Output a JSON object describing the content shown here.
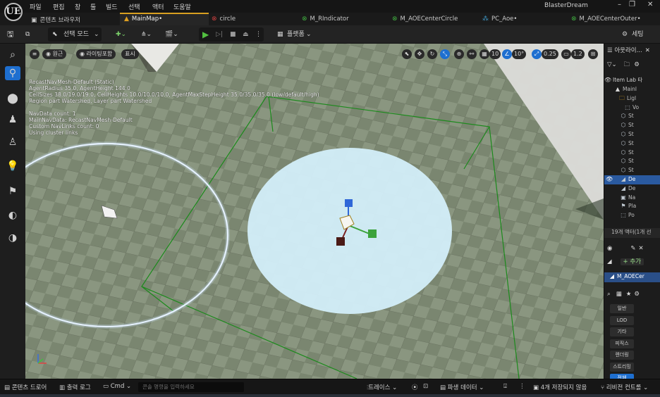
{
  "menubar": {
    "items": [
      "파일",
      "편집",
      "창",
      "툴",
      "빌드",
      "선택",
      "액터",
      "도움말"
    ],
    "project": "BlasterDream",
    "logo": "UE"
  },
  "tabs": [
    {
      "label": "콘텐츠 브라우저",
      "icon": "content-browser-icon"
    },
    {
      "label": "MainMap•",
      "icon": "level-icon",
      "active": true
    },
    {
      "label": "circle",
      "icon": "material-icon"
    },
    {
      "label": "M_RIndicator",
      "icon": "material-instance-icon"
    },
    {
      "label": "M_AOECenterCircle",
      "icon": "material-instance-icon"
    },
    {
      "label": "PC_Aoe•",
      "icon": "blueprint-icon"
    },
    {
      "label": "M_AOECenterOuter•",
      "icon": "material-instance-icon"
    }
  ],
  "toolbar": {
    "select_mode": "선택 모드",
    "platforms": "플랫폼",
    "settings": "세팅"
  },
  "viewport": {
    "view_menu": "원근",
    "lighting": "라이팅포함",
    "show": "표시",
    "grid_size": "10",
    "rotation_snap": "10°",
    "scale_snap": "0.25",
    "camera_speed": "1.2",
    "debug_text": [
      "RecastNavMesh-Default (Static)",
      "AgentRadius 35.0, AgentHeight 144.0",
      "CellSizes 38.0/19.0/19.0, CellHeights 10.0/10.0/10.0, AgentMaxStepHeight 35.0/35.0/35.0 (low/default/high)",
      "Region part Watershed, Layer part Watershed",
      "",
      "NavData count: 1",
      "MainNavData: RecastNavMesh-Default",
      "Custom NavLinks count: 0",
      "Using cluster links"
    ]
  },
  "outliner": {
    "title": "아웃라이...",
    "root": "Item Lab 타",
    "rows": [
      {
        "label": "Mainl",
        "icon": "level-icon"
      },
      {
        "label": "Ligl",
        "icon": "folder-icon"
      },
      {
        "label": "Vo",
        "icon": "volume-icon"
      },
      {
        "label": "St",
        "icon": "static-mesh-icon"
      },
      {
        "label": "St",
        "icon": "static-mesh-icon"
      },
      {
        "label": "St",
        "icon": "static-mesh-icon"
      },
      {
        "label": "St",
        "icon": "static-mesh-icon"
      },
      {
        "label": "St",
        "icon": "static-mesh-icon"
      },
      {
        "label": "St",
        "icon": "static-mesh-icon"
      },
      {
        "label": "St",
        "icon": "static-mesh-icon"
      },
      {
        "label": "De",
        "icon": "decal-icon",
        "selected": true
      },
      {
        "label": "De",
        "icon": "decal-icon"
      },
      {
        "label": "Na",
        "icon": "navmesh-icon"
      },
      {
        "label": "Pla",
        "icon": "player-start-icon"
      },
      {
        "label": "Po",
        "icon": "volume-icon"
      }
    ],
    "count": "19개 액터(1개 선"
  },
  "details": {
    "add": "+ 추가",
    "component": "M_AOECer",
    "categories": [
      "일반",
      "LOD",
      "기타",
      "피직스",
      "렌더링",
      "스트리밍",
      "전체"
    ]
  },
  "statusbar": {
    "content_drawer": "콘텐츠 드로어",
    "output_log": "출력 로그",
    "cmd": "Cmd",
    "cmd_placeholder": "콘솔 명령을 입력하세요",
    "trace": "트레이스",
    "derived_data": "파생 데이터",
    "unsaved": "4개 저장되지 않음",
    "revision": "리비전 컨트롤"
  }
}
